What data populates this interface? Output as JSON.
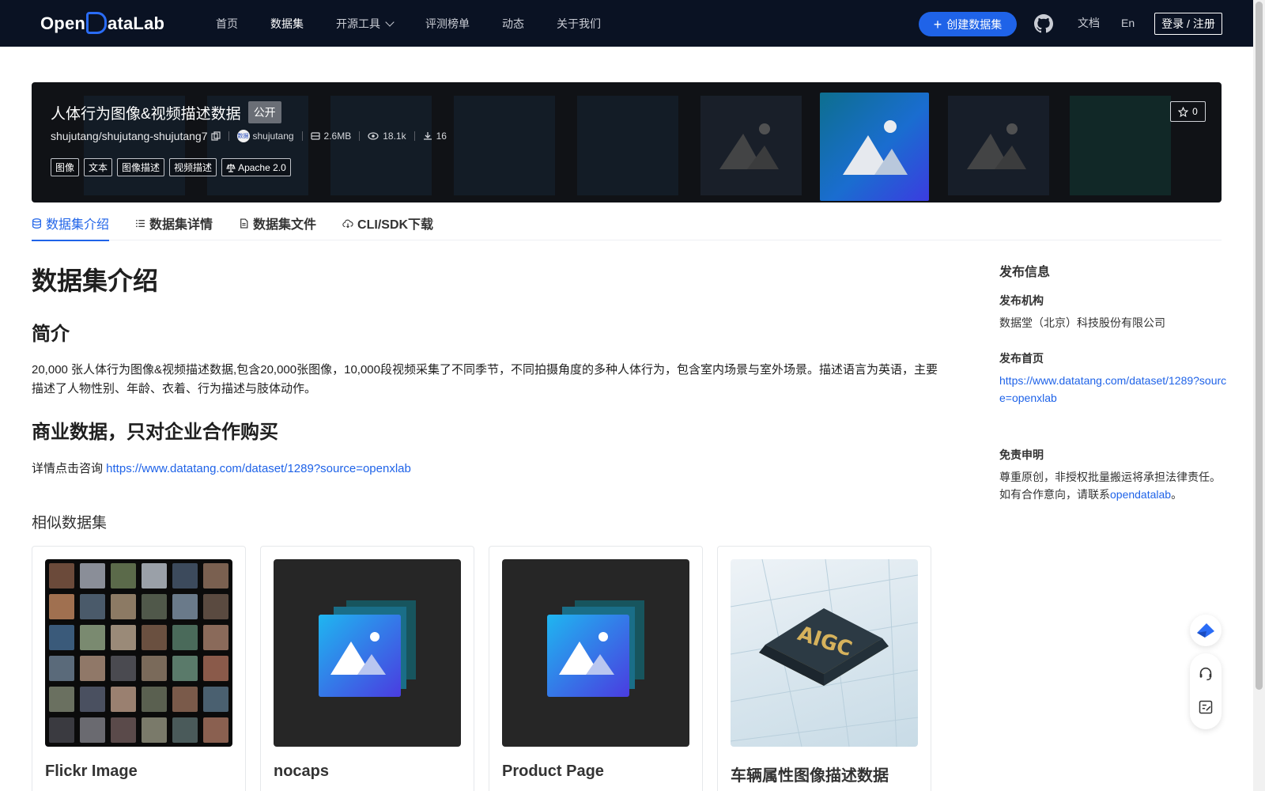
{
  "nav": {
    "logo_text_left": "Open",
    "logo_text_right": "ataLab",
    "links": [
      {
        "label": "首页"
      },
      {
        "label": "数据集"
      },
      {
        "label": "开源工具"
      },
      {
        "label": "评测榜单"
      },
      {
        "label": "动态"
      },
      {
        "label": "关于我们"
      }
    ],
    "create_label": "创建数据集",
    "docs_label": "文档",
    "lang_label": "En",
    "login_label": "登录 / 注册"
  },
  "hero": {
    "title": "人体行为图像&视频描述数据",
    "badge": "公开",
    "repo": "shujutang/shujutang-shujutang7",
    "avatar_text": "数据",
    "owner": "shujutang",
    "size": "2.6MB",
    "views": "18.1k",
    "downloads": "16",
    "tags": [
      "图像",
      "文本",
      "图像描述",
      "视频描述"
    ],
    "license": "Apache 2.0",
    "stars": "0"
  },
  "tabs": [
    {
      "label": "数据集介绍"
    },
    {
      "label": "数据集详情"
    },
    {
      "label": "数据集文件"
    },
    {
      "label": "CLI/SDK下载"
    }
  ],
  "content": {
    "h1": "数据集介绍",
    "intro_heading": "简介",
    "intro_text": "20,000 张人体行为图像&视频描述数据,包含20,000张图像，10,000段视频采集了不同季节，不同拍摄角度的多种人体行为，包含室内场景与室外场景。描述语言为英语，主要描述了人物性别、年龄、衣着、行为描述与肢体动作。",
    "biz_heading": "商业数据，只对企业合作购买",
    "detail_prefix": "详情点击咨询 ",
    "detail_link": "https://www.datatang.com/dataset/1289?source=openxlab",
    "similar_title": "相似数据集",
    "cards": [
      {
        "title": "Flickr Image"
      },
      {
        "title": "nocaps"
      },
      {
        "title": "Product Page"
      },
      {
        "title": "车辆属性图像描述数据",
        "image_text": "AIGC"
      }
    ]
  },
  "sidebar": {
    "heading": "发布信息",
    "org_label": "发布机构",
    "org_value": "数据堂（北京）科技股份有限公司",
    "home_label": "发布首页",
    "home_link": "https://www.datatang.com/dataset/1289?source=openxlab",
    "disclaimer_label": "免责申明",
    "disclaimer_line1": "尊重原创，非授权批量搬运将承担法律责任。",
    "disclaimer_line2_prefix": "如有合作意向，请联系",
    "disclaimer_link": "opendatalab",
    "disclaimer_suffix": "。"
  },
  "colors": {
    "nav_bg": "#0a1223",
    "accent": "#1f63e8",
    "hero_bg": "#101216"
  },
  "icons": [
    "github-icon",
    "copy-icon",
    "database-icon",
    "eye-icon",
    "download-icon",
    "license-icon",
    "star-icon",
    "list-icon",
    "file-icon",
    "cloud-icon",
    "chevron-down-icon",
    "plus-icon",
    "image-placeholder-icon",
    "headset-icon",
    "feedback-icon"
  ]
}
